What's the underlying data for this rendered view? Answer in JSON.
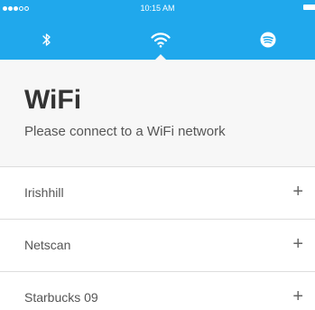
{
  "status_bar": {
    "time": "10:15 AM",
    "signal_dots_filled": 3,
    "signal_dots_empty": 2
  },
  "tabs": [
    {
      "id": "bluetooth",
      "icon": "bluetooth-icon",
      "active": false
    },
    {
      "id": "wifi",
      "icon": "wifi-icon",
      "active": true
    },
    {
      "id": "spotify",
      "icon": "spotify-icon",
      "active": false
    }
  ],
  "page": {
    "title": "WiFi",
    "subtitle": "Please connect to a WiFi network"
  },
  "networks": [
    {
      "name": "Irishhill",
      "action": "+"
    },
    {
      "name": "Netscan",
      "action": "+"
    },
    {
      "name": "Starbucks 09",
      "action": "+"
    }
  ],
  "colors": {
    "header": "#20a8ec",
    "panel": "#f7f7f7",
    "title": "#333333",
    "text": "#555555",
    "divider": "#dddddd"
  }
}
